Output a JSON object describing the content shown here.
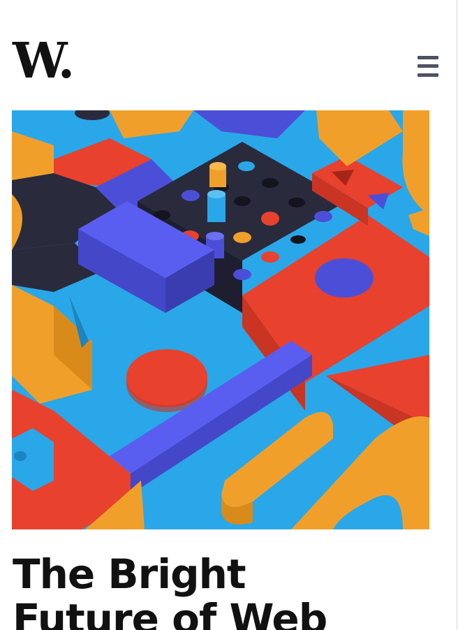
{
  "header": {
    "logo_text": "W.",
    "menu_icon": "hamburger-menu-icon",
    "menu_color": "#4e5363"
  },
  "hero": {
    "description": "Colorful 3D geometric blocks and shapes illustration",
    "palette": {
      "blue": "#2aa7e8",
      "indigo": "#4b4fd8",
      "red": "#e8412d",
      "orange": "#f0a02a",
      "navy": "#2a2a3d"
    }
  },
  "article": {
    "title_lines": [
      "The Bright",
      "Future of Web"
    ]
  }
}
